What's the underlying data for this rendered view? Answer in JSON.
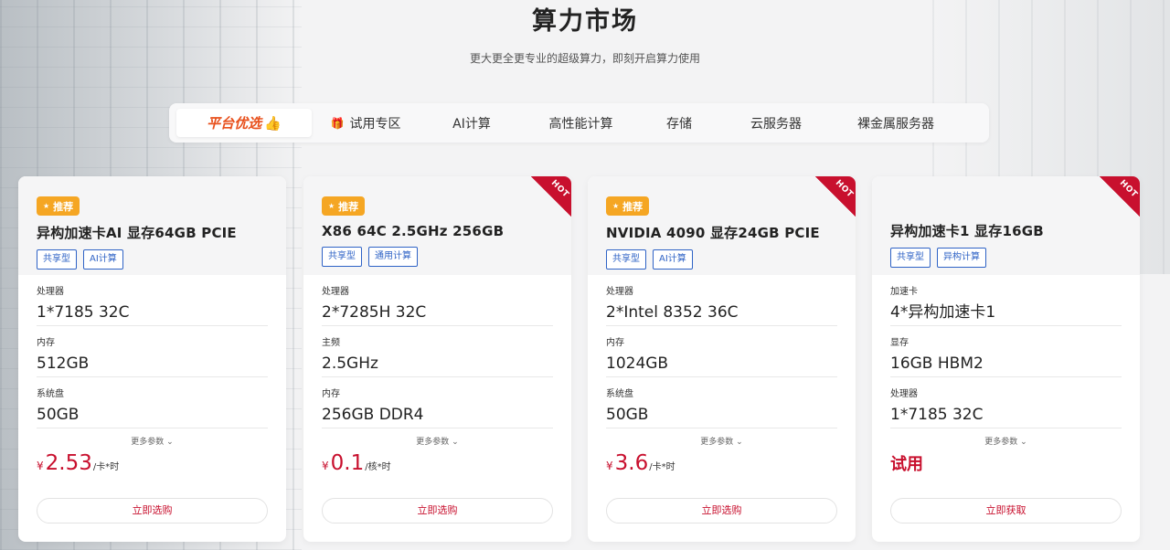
{
  "header": {
    "title": "算力市场",
    "subtitle": "更大更全更专业的超级算力，即刻开启算力使用"
  },
  "tabs": [
    {
      "label": "平台优选",
      "icon": "thumbs-up-icon",
      "active": true
    },
    {
      "label": "试用专区",
      "icon": "gift-icon"
    },
    {
      "label": "AI计算"
    },
    {
      "label": "高性能计算"
    },
    {
      "label": "存储"
    },
    {
      "label": "云服务器"
    },
    {
      "label": "裸金属服务器"
    }
  ],
  "colors": {
    "accent": "#c8102e",
    "tag": "#2f63c6",
    "badge": "#f5a623",
    "active_tab": "#e8501c"
  },
  "cards": [
    {
      "badge": "推荐",
      "name": "异构加速卡AI 显存64GB PCIE",
      "hot": false,
      "tags": [
        "共享型",
        "AI计算"
      ],
      "specs": [
        {
          "label": "处理器",
          "value": "1*7185 32C"
        },
        {
          "label": "内存",
          "value": "512GB"
        },
        {
          "label": "系统盘",
          "value": "50GB"
        }
      ],
      "more": "更多参数",
      "price": {
        "currency": "¥",
        "value": "2.53",
        "unit": "/卡*时"
      },
      "button": "立即选购"
    },
    {
      "badge": "推荐",
      "name": "X86 64C 2.5GHz 256GB",
      "hot": true,
      "hot_label": "HOT",
      "tags": [
        "共享型",
        "通用计算"
      ],
      "specs": [
        {
          "label": "处理器",
          "value": "2*7285H 32C"
        },
        {
          "label": "主频",
          "value": "2.5GHz"
        },
        {
          "label": "内存",
          "value": "256GB DDR4"
        }
      ],
      "more": "更多参数",
      "price": {
        "currency": "¥",
        "value": "0.1",
        "unit": "/核*时"
      },
      "button": "立即选购"
    },
    {
      "badge": "推荐",
      "name": "NVIDIA 4090 显存24GB PCIE",
      "hot": true,
      "hot_label": "HOT",
      "tags": [
        "共享型",
        "AI计算"
      ],
      "specs": [
        {
          "label": "处理器",
          "value": "2*Intel 8352 36C"
        },
        {
          "label": "内存",
          "value": "1024GB"
        },
        {
          "label": "系统盘",
          "value": "50GB"
        }
      ],
      "more": "更多参数",
      "price": {
        "currency": "¥",
        "value": "3.6",
        "unit": "/卡*时"
      },
      "button": "立即选购"
    },
    {
      "name": "异构加速卡1 显存16GB",
      "hot": true,
      "hot_label": "HOT",
      "tags": [
        "共享型",
        "异构计算"
      ],
      "specs": [
        {
          "label": "加速卡",
          "value": "4*异构加速卡1"
        },
        {
          "label": "显存",
          "value": "16GB HBM2"
        },
        {
          "label": "处理器",
          "value": "1*7185 32C"
        }
      ],
      "more": "更多参数",
      "price": {
        "trial": "试用"
      },
      "button": "立即获取"
    }
  ]
}
